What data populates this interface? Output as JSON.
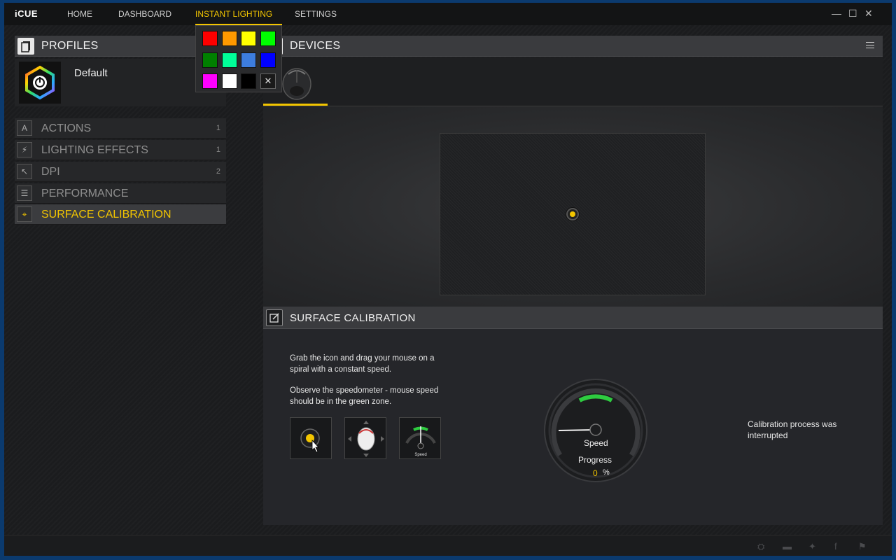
{
  "app": {
    "logo": "iCUE"
  },
  "nav": {
    "items": [
      {
        "label": "HOME",
        "active": false
      },
      {
        "label": "DASHBOARD",
        "active": false
      },
      {
        "label": "INSTANT LIGHTING",
        "active": true
      },
      {
        "label": "SETTINGS",
        "active": false
      }
    ]
  },
  "window_controls": {
    "minimize": "—",
    "maximize": "☐",
    "close": "✕"
  },
  "profiles": {
    "title": "PROFILES",
    "profile_name": "Default"
  },
  "menu": [
    {
      "label": "ACTIONS",
      "count": "1",
      "icon": "letter-a-icon",
      "glyph": "A"
    },
    {
      "label": "LIGHTING EFFECTS",
      "count": "1",
      "icon": "lightning-icon",
      "glyph": "⚡"
    },
    {
      "label": "DPI",
      "count": "2",
      "icon": "cursor-icon",
      "glyph": "↖"
    },
    {
      "label": "PERFORMANCE",
      "count": "",
      "icon": "sliders-icon",
      "glyph": "☰"
    },
    {
      "label": "SURFACE CALIBRATION",
      "count": "",
      "icon": "crosshair-icon",
      "glyph": "⌖",
      "active": true
    }
  ],
  "instant_lighting_colors": [
    "#ff0000",
    "#ff9900",
    "#ffff00",
    "#00ff00",
    "#008000",
    "#00ff99",
    "#3d7dde",
    "#0000ff",
    "#ff00ff",
    "#ffffff",
    "#000000"
  ],
  "clear_glyph": "✕",
  "devices": {
    "title": "DEVICES"
  },
  "calibration": {
    "title": "SURFACE CALIBRATION",
    "instruction_1": "Grab the icon and drag your mouse on a spiral with a constant speed.",
    "instruction_2": "Observe the speedometer - mouse speed should be in the green zone.",
    "step_speed_label": "Speed",
    "gauge_speed_label": "Speed",
    "gauge_progress_label": "Progress",
    "progress_value": "0",
    "progress_unit": "%",
    "status": "Calibration process was interrupted"
  },
  "colors": {
    "accent": "#f2c500",
    "green_zone": "#2ecc40"
  }
}
